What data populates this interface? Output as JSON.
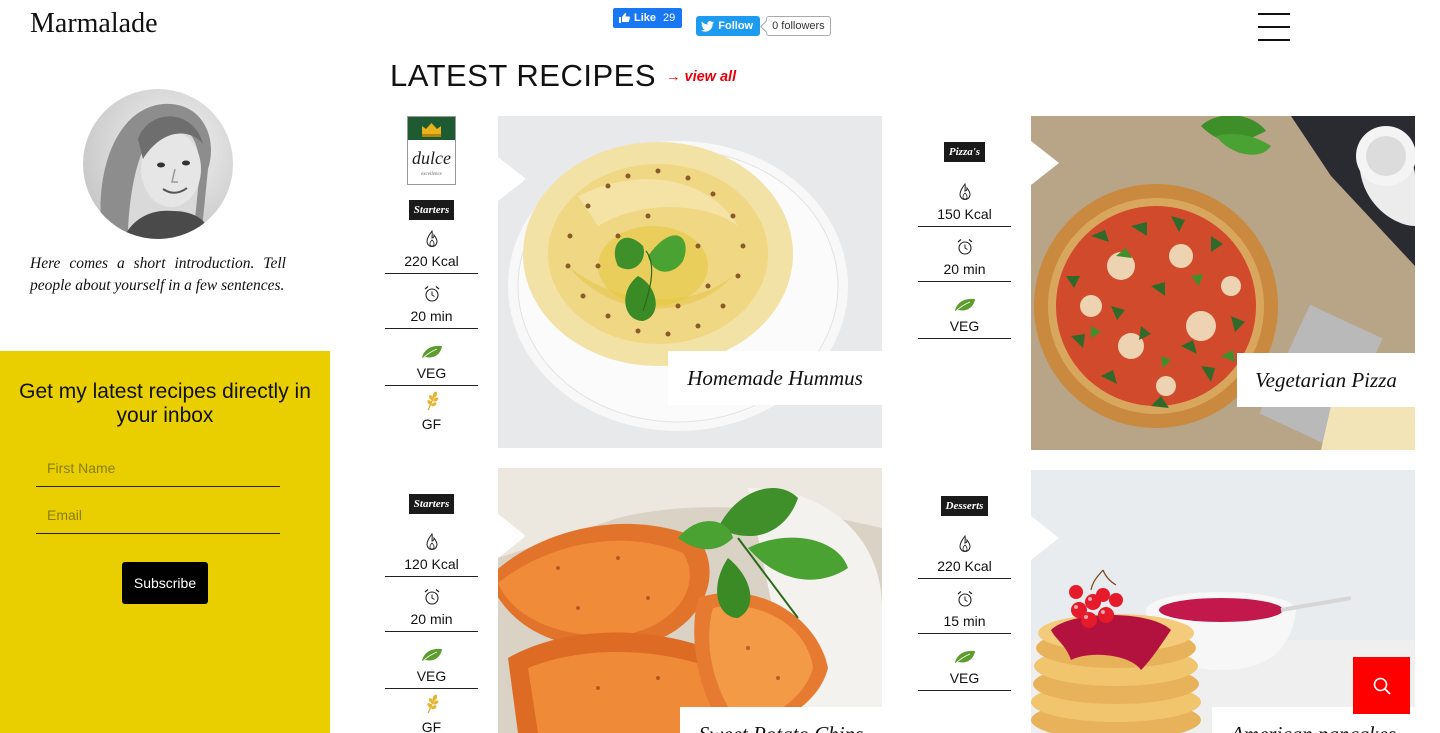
{
  "header": {
    "logo": "Marmalade",
    "fb_like_label": "Like",
    "fb_like_count": "29",
    "tw_follow_label": "Follow",
    "tw_followers": "0 followers"
  },
  "sidebar": {
    "intro": "Here comes a short introduction. Tell people about yourself in a few sentences.",
    "newsletter_title": "Get my latest recipes directly in your inbox",
    "first_name_placeholder": "First Name",
    "email_placeholder": "Email",
    "subscribe_label": "Subscribe"
  },
  "section": {
    "title": "LATEST RECIPES",
    "view_all": "→ view all"
  },
  "recipes": [
    {
      "title": "Homemade Hummus",
      "category": "Starters",
      "brand": "dulce",
      "brand_sub": "excellence",
      "kcal": "220 Kcal",
      "time": "20 min",
      "tags": [
        "VEG",
        "GF"
      ]
    },
    {
      "title": "Vegetarian Pizza",
      "category": "Pizza's",
      "kcal": "150 Kcal",
      "time": "20 min",
      "tags": [
        "VEG"
      ]
    },
    {
      "title": "Sweet Potato Chips",
      "category": "Starters",
      "kcal": "120 Kcal",
      "time": "20 min",
      "tags": [
        "VEG",
        "GF"
      ]
    },
    {
      "title": "American pancakes",
      "category": "Desserts",
      "kcal": "220 Kcal",
      "time": "15 min",
      "tags": [
        "VEG"
      ]
    }
  ],
  "colors": {
    "accent_red": "#e8000c",
    "newsletter_bg": "#e9cf00",
    "search_button": "#ff0000",
    "badge_dark": "#1a1a1a"
  },
  "icons": [
    "hamburger-menu-icon",
    "flame-icon",
    "alarm-clock-icon",
    "leaf-icon",
    "wheat-icon",
    "search-icon",
    "thumbs-up-icon",
    "twitter-bird-icon"
  ]
}
